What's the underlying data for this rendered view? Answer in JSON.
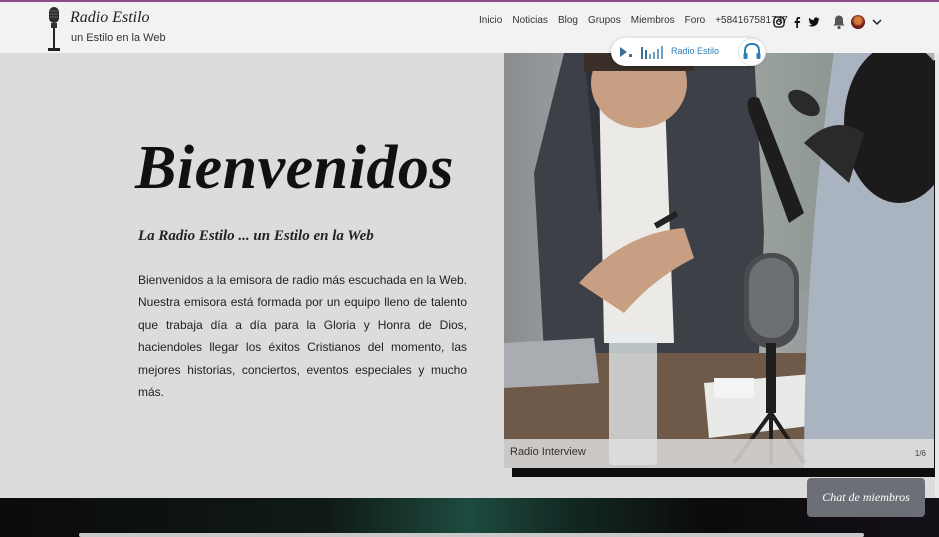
{
  "brand": {
    "title": "Radio Estilo",
    "subtitle": "un Estilo en la Web"
  },
  "nav": {
    "items": [
      "Inicio",
      "Noticias",
      "Blog",
      "Grupos",
      "Miembros",
      "Foro",
      "+584167581747"
    ]
  },
  "icons": {
    "logo": "microphone-icon",
    "social": [
      "instagram-icon",
      "facebook-icon",
      "twitter-icon"
    ],
    "notifications": "bell-icon",
    "account": "avatar",
    "menu": "chevron-down-icon",
    "player_play": "play-icon",
    "player_volume": "volume-bars-icon",
    "player_headphones": "headphones-icon"
  },
  "player": {
    "station": "Radio Estilo"
  },
  "hero": {
    "title": "Bienvenidos",
    "subtitle": "La Radio Estilo ... un Estilo en la Web",
    "paragraph": "Bienvenidos a la emisora de radio más escuchada en la Web. Nuestra emisora está formada por un equipo lleno de talento que trabaja día a día para la Gloria y Honra de Dios, haciendoles llegar los éxitos Cristianos del momento, las mejores historias, conciertos, eventos especiales y mucho más."
  },
  "gallery": {
    "caption": "Radio Interview",
    "counter": "1/6"
  },
  "chat": {
    "label": "Chat de miembros"
  },
  "colors": {
    "accent_line": "#8e4b8c",
    "hero_bg": "#dcdcdc",
    "player_text": "#2d7fb8",
    "chat_bg": "#6c6f76"
  }
}
